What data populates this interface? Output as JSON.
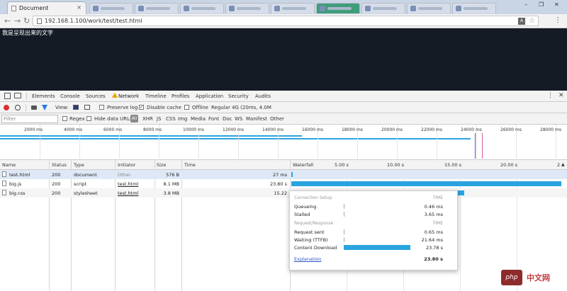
{
  "browser": {
    "tab_title": "Document",
    "tab_close": "×",
    "url": "192.168.1.100/work/test/test.html",
    "window_controls": [
      "–",
      "❐",
      "✕"
    ]
  },
  "page": {
    "text": "我是呈现出来的文字"
  },
  "devtools": {
    "tabs": [
      "Elements",
      "Console",
      "Sources",
      "Network",
      "Timeline",
      "Profiles",
      "Application",
      "Security",
      "Audits"
    ],
    "network_toolbar": {
      "view_label": "View:",
      "preserve_log": "Preserve log",
      "disable_cache": "Disable cache",
      "offline": "Offline",
      "throttle": "Regular 4G (20ms, 4.0M"
    },
    "filter": {
      "placeholder": "Filter",
      "regex": "Regex",
      "hide_data_urls": "Hide data URLs",
      "types": [
        "All",
        "XHR",
        "JS",
        "CSS",
        "Img",
        "Media",
        "Font",
        "Doc",
        "WS",
        "Manifest",
        "Other"
      ]
    },
    "overview_ticks": [
      "2000 ms",
      "4000 ms",
      "6000 ms",
      "8000 ms",
      "10000 ms",
      "12000 ms",
      "14000 ms",
      "16000 ms",
      "18000 ms",
      "20000 ms",
      "22000 ms",
      "24000 ms",
      "26000 ms",
      "28000 ms"
    ],
    "columns": {
      "name": "Name",
      "status": "Status",
      "type": "Type",
      "initiator": "Initiator",
      "size": "Size",
      "time": "Time",
      "waterfall": "Waterfall"
    },
    "waterfall_ticks": [
      "5.00 s",
      "10.00 s",
      "15.00 s",
      "20.00 s",
      "2"
    ],
    "rows": [
      {
        "name": "test.html",
        "status": "200",
        "type": "document",
        "initiator": "Other",
        "size": "576 B",
        "time": "27 ms",
        "wf_start_s": 0.0,
        "wf_dur_s": 0.03
      },
      {
        "name": "big.js",
        "status": "200",
        "type": "script",
        "initiator": "test.html",
        "size": "8.1 MB",
        "time": "23.80 s",
        "wf_start_s": 0.03,
        "wf_dur_s": 23.8
      },
      {
        "name": "big.css",
        "status": "200",
        "type": "stylesheet",
        "initiator": "test.html",
        "size": "3.8 MB",
        "time": "15.22",
        "wf_start_s": 0.03,
        "wf_dur_s": 15.22
      }
    ],
    "timing_popup": {
      "section1": "Connection Setup",
      "section2": "Request/Response",
      "time_header": "TIME",
      "items": [
        {
          "label": "Queueing",
          "value": "0.46 ms",
          "seconds": 0.00046
        },
        {
          "label": "Stalled",
          "value": "3.65 ms",
          "seconds": 0.00365
        },
        {
          "label": "Request sent",
          "value": "0.65 ms",
          "seconds": 0.00065
        },
        {
          "label": "Waiting (TTFB)",
          "value": "21.64 ms",
          "seconds": 0.02164
        },
        {
          "label": "Content Download",
          "value": "23.78 s",
          "seconds": 23.78
        }
      ],
      "explanation": "Explanation",
      "total": "23.80 s"
    }
  },
  "watermark": {
    "php": "php",
    "cn": "中文网"
  },
  "colors": {
    "accent": "#29a4df",
    "page_bg": "#141b25",
    "record": "#d83030"
  }
}
